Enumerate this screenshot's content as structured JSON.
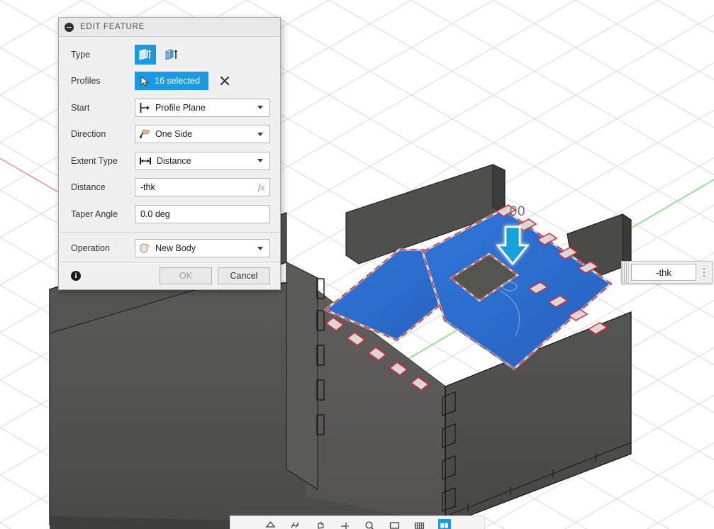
{
  "app": {
    "background_color": "#ffffff",
    "grid_line_color": "#dcdcdc",
    "axis_x_color": "#e38a8a",
    "axis_y_color": "#7fdc7f",
    "accent_color": "#1a9ae0",
    "highlight_face_color": "#2a6fd4",
    "body_color": "#4e4e4c",
    "edge_highlight_color": "#e8202a"
  },
  "dialog": {
    "title": "EDIT FEATURE",
    "collapse_icon": "minus-circle-icon",
    "rows": {
      "type": {
        "label": "Type",
        "options": [
          {
            "icon": "extrude-solid-icon",
            "selected": true
          },
          {
            "icon": "extrude-thin-icon",
            "selected": false
          }
        ]
      },
      "profiles": {
        "label": "Profiles",
        "selection_icon": "cursor-arrow-icon",
        "value": "16 selected",
        "clear_icon": "close-x-icon"
      },
      "start": {
        "label": "Start",
        "icon": "profile-plane-icon",
        "value": "Profile Plane"
      },
      "direction": {
        "label": "Direction",
        "icon": "one-side-arrow-icon",
        "value": "One Side"
      },
      "extent_type": {
        "label": "Extent Type",
        "icon": "distance-icon",
        "value": "Distance"
      },
      "distance": {
        "label": "Distance",
        "value": "-thk",
        "fx_label": "fx"
      },
      "taper_angle": {
        "label": "Taper Angle",
        "value": "0.0 deg"
      },
      "operation": {
        "label": "Operation",
        "icon": "new-body-icon",
        "value": "New Body"
      }
    },
    "footer": {
      "info_icon": "info-icon",
      "info_glyph": "i",
      "ok_label": "OK",
      "ok_enabled": false,
      "cancel_label": "Cancel",
      "cancel_enabled": true
    }
  },
  "canvas": {
    "dimension_text": ".00",
    "manipulator_icon": "down-arrow-manipulator-icon",
    "floating_input": {
      "value": "-thk",
      "grip_icon": "drag-grip-icon",
      "menu_icon": "kebab-menu-icon"
    }
  },
  "bottom_toolbar": {
    "items": [
      {
        "icon": "orbit-icon",
        "active": false
      },
      {
        "icon": "look-at-icon",
        "active": false
      },
      {
        "icon": "pan-icon",
        "active": false
      },
      {
        "icon": "zoom-icon",
        "active": false
      },
      {
        "icon": "zoom-window-icon",
        "active": false
      },
      {
        "icon": "display-settings-icon",
        "active": false
      },
      {
        "icon": "grid-snap-icon",
        "active": false
      },
      {
        "icon": "viewports-icon",
        "active": true
      }
    ]
  }
}
